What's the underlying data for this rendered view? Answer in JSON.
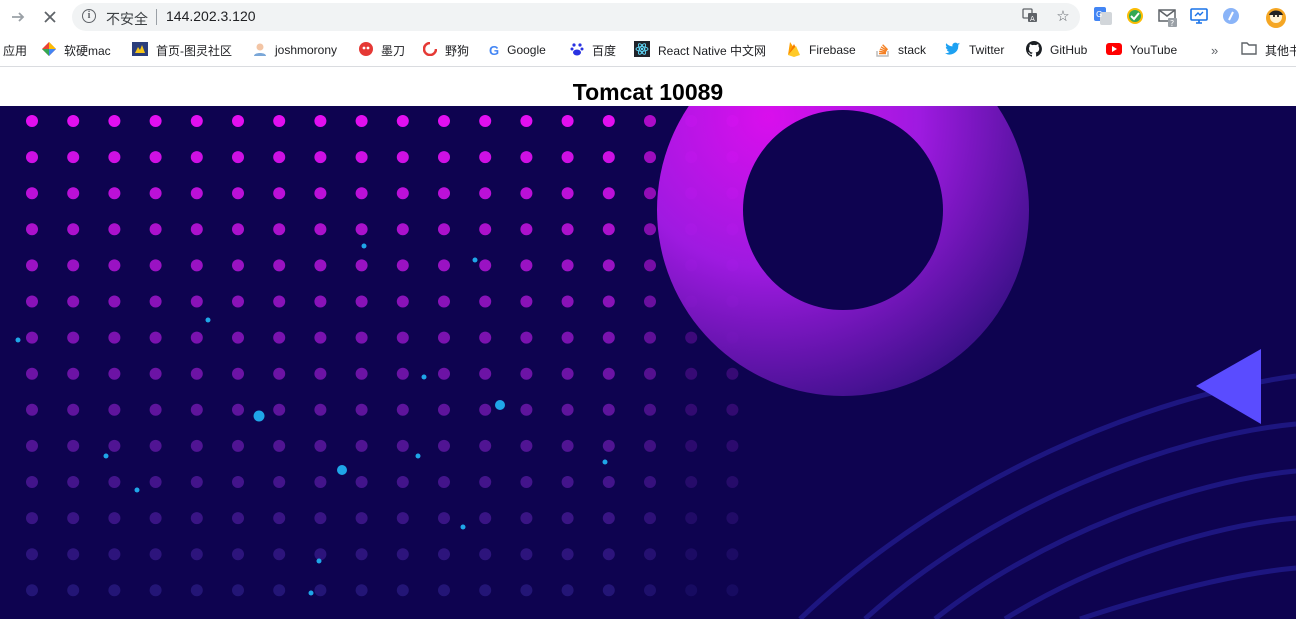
{
  "browser": {
    "security_label": "不安全",
    "url": "144.202.3.120"
  },
  "bookmarks": [
    {
      "label": "应用",
      "icon": "apps-icon"
    },
    {
      "label": "软硬mac",
      "icon": "diamond-icon"
    },
    {
      "label": "首页-图灵社区",
      "icon": "turing-icon"
    },
    {
      "label": "joshmorony",
      "icon": "avatar-icon"
    },
    {
      "label": "墨刀",
      "icon": "modao-icon"
    },
    {
      "label": "野狗",
      "icon": "wilddog-icon"
    },
    {
      "label": "Google",
      "icon": "google-icon"
    },
    {
      "label": "百度",
      "icon": "baidu-icon"
    },
    {
      "label": "React Native 中文网",
      "icon": "react-icon"
    },
    {
      "label": "Firebase",
      "icon": "firebase-icon"
    },
    {
      "label": "stack",
      "icon": "stackoverflow-icon"
    },
    {
      "label": "Twitter",
      "icon": "twitter-icon"
    },
    {
      "label": "GitHub",
      "icon": "github-icon"
    },
    {
      "label": "YouTube",
      "icon": "youtube-icon"
    }
  ],
  "overflow_label": "»",
  "other_bookmarks_label": "其他书",
  "page": {
    "title": "Tomcat 10089"
  },
  "colors": {
    "hero_bg": "#0e0350",
    "dot_top": "#e20ff0",
    "dot_bottom": "#2f1f8a",
    "particle": "#1fa6e8",
    "triangle": "#5a4cff"
  }
}
